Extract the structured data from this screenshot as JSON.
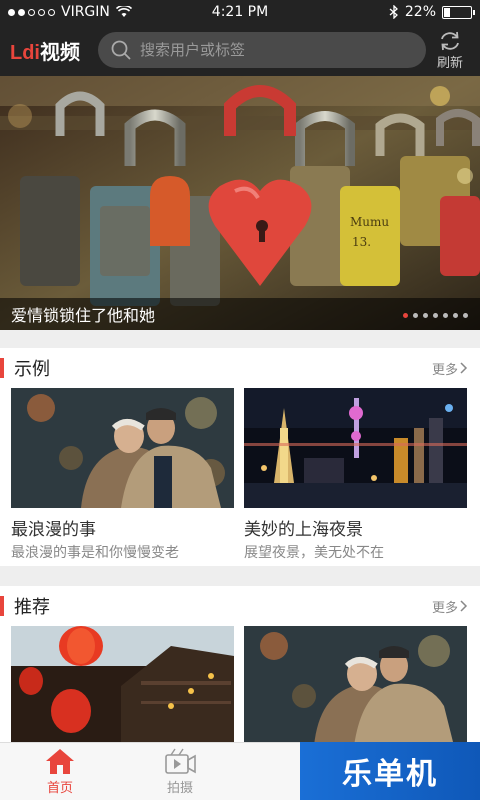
{
  "status_bar": {
    "carrier": "VIRGIN",
    "time": "4:21 PM",
    "battery_text": "22%",
    "battery_level": 0.22,
    "signal_bars": 2
  },
  "header": {
    "logo_brand": "Ldi",
    "logo_text": "视频",
    "search_placeholder": "搜索用户或标签",
    "refresh_label": "刷新"
  },
  "banner": {
    "caption": "爱情锁锁住了他和她",
    "slide_count": 7,
    "active_index": 0,
    "lock_text": "Mumu\n13."
  },
  "sections": [
    {
      "title": "示例",
      "more": "更多",
      "cards": [
        {
          "title": "最浪漫的事",
          "subtitle": "最浪漫的事是和你慢慢变老",
          "image": "elderly-couple"
        },
        {
          "title": "美妙的上海夜景",
          "subtitle": "展望夜景，美无处不在",
          "image": "shanghai-night"
        }
      ]
    },
    {
      "title": "推荐",
      "more": "更多",
      "cards": [
        {
          "title": "",
          "subtitle": "",
          "image": "lantern-street"
        },
        {
          "title": "",
          "subtitle": "",
          "image": "elderly-couple"
        }
      ]
    }
  ],
  "tabbar": {
    "items": [
      {
        "label": "首页",
        "icon": "home-icon",
        "active": true
      },
      {
        "label": "拍摄",
        "icon": "video-camera-icon",
        "active": false
      }
    ]
  },
  "watermark": "乐单机",
  "colors": {
    "accent": "#e8453c",
    "header_bg": "#232323",
    "watermark_bg": "#1a6fd6"
  }
}
